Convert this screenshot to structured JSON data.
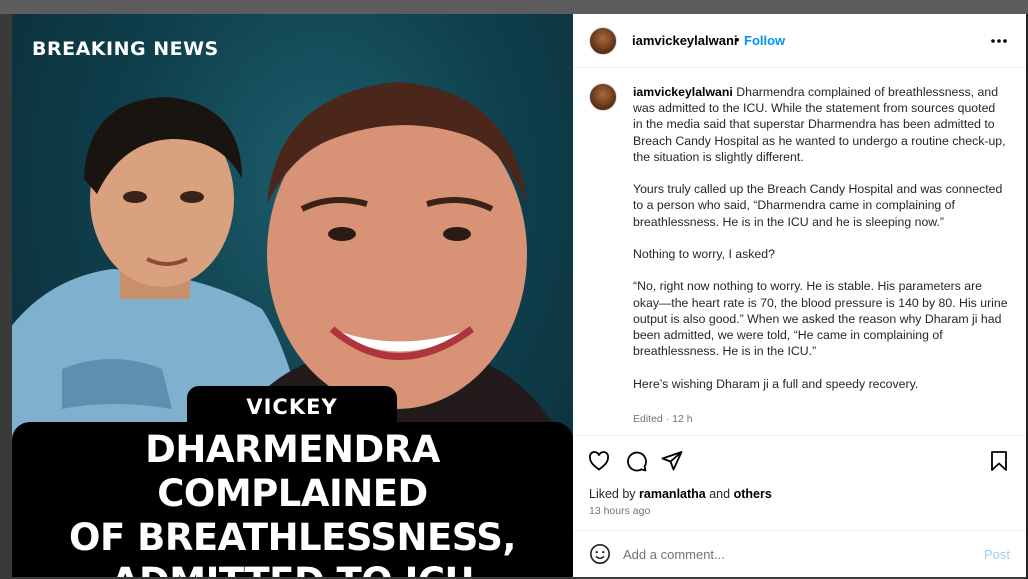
{
  "media": {
    "breaking_label": "BREAKING NEWS",
    "name_tag": "VICKEY LALWANI",
    "headline_lines": [
      "DHARMENDRA COMPLAINED",
      "OF BREATHLESSNESS,",
      "ADMITTED TO ICU"
    ]
  },
  "header": {
    "username": "iamvickeylalwani",
    "separator": "•",
    "follow_label": "Follow",
    "more_icon": "more-horizontal-icon"
  },
  "caption": {
    "username": "iamvickeylalwani",
    "paragraphs": [
      "Dharmendra complained of breathlessness, and was admitted to the ICU. While the statement from sources quoted in the media said that superstar Dharmendra has been admitted to Breach Candy Hospital as he wanted to undergo a routine check-up, the situation is slightly different.",
      "Yours truly called up the Breach Candy Hospital and was connected to a person who said, “Dharmendra came in complaining of breathlessness. He is in the ICU and he is sleeping now.”",
      "Nothing to worry, I asked?",
      "“No, right now nothing to worry. He is stable. His parameters are okay—the heart rate is 70, the blood pressure is 140 by 80. His urine output is also good.” When we asked the reason why Dharam ji had been admitted, we were told, “He came in complaining of breathlessness. He is in the ICU.”",
      "Here’s wishing Dharam ji a full and speedy recovery."
    ],
    "meta": "Edited · 12 h"
  },
  "actions": {
    "icons": [
      "heart-icon",
      "comment-icon",
      "share-icon",
      "bookmark-icon"
    ],
    "liked_prefix": "Liked by",
    "liked_user": "ramanlatha",
    "liked_and": "and",
    "liked_others": "others",
    "time_ago": "13 hours ago"
  },
  "comment": {
    "placeholder": "Add a comment...",
    "post_label": "Post",
    "emoji_icon": "emoji-icon"
  },
  "colors": {
    "accent": "#0095f6",
    "post_disabled": "#9ecff6",
    "media_bg": "#0f3f4c"
  }
}
